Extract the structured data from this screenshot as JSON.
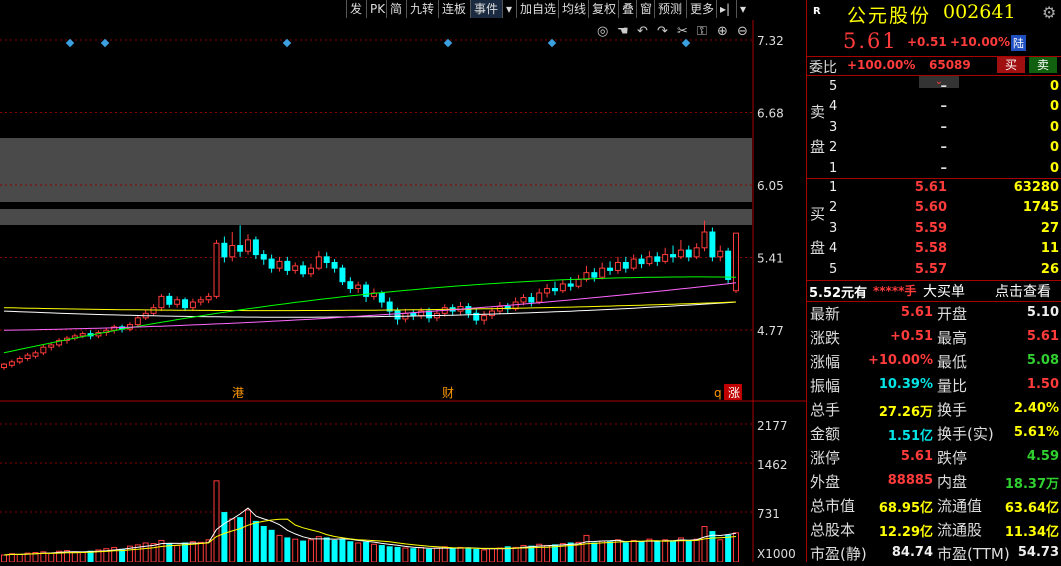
{
  "toolbar": {
    "items": [
      "发",
      "PK",
      "简",
      "九转",
      "连板",
      "事件",
      "▾",
      "加自选",
      "均线",
      "复权",
      "叠",
      "窗",
      "预测",
      "更多",
      "▸|",
      "▾"
    ]
  },
  "chart": {
    "price_ticks": [
      "7.32",
      "6.68",
      "6.05",
      "5.41",
      "4.77"
    ],
    "volume_ticks": [
      "2177",
      "1462",
      "731",
      "X1000"
    ],
    "markers": [
      "港",
      "财",
      "q",
      "涨"
    ],
    "icons": [
      "eye-icon",
      "hand-icon",
      "undo-icon",
      "redo-icon",
      "cut-icon",
      "lock-icon",
      "zoom-in-icon",
      "zoom-out-icon"
    ]
  },
  "chart_data": {
    "type": "candlestick",
    "price_axis": [
      4.77,
      7.32
    ],
    "volume_axis": [
      0,
      2177
    ],
    "volume_unit": "X1000",
    "candles": [
      [
        4.42,
        4.45,
        4.4,
        4.46
      ],
      [
        4.44,
        4.47,
        4.42,
        4.49
      ],
      [
        4.47,
        4.5,
        4.45,
        4.52
      ],
      [
        4.5,
        4.53,
        4.48,
        4.55
      ],
      [
        4.52,
        4.55,
        4.5,
        4.57
      ],
      [
        4.55,
        4.6,
        4.53,
        4.62
      ],
      [
        4.6,
        4.62,
        4.57,
        4.64
      ],
      [
        4.62,
        4.66,
        4.6,
        4.68
      ],
      [
        4.66,
        4.68,
        4.63,
        4.7
      ],
      [
        4.68,
        4.7,
        4.66,
        4.72
      ],
      [
        4.7,
        4.72,
        4.68,
        4.74
      ],
      [
        4.72,
        4.7,
        4.67,
        4.75
      ],
      [
        4.7,
        4.73,
        4.68,
        4.75
      ],
      [
        4.73,
        4.75,
        4.7,
        4.77
      ],
      [
        4.75,
        4.78,
        4.72,
        4.8
      ],
      [
        4.78,
        4.76,
        4.73,
        4.8
      ],
      [
        4.76,
        4.8,
        4.74,
        4.82
      ],
      [
        4.8,
        4.86,
        4.78,
        4.88
      ],
      [
        4.86,
        4.9,
        4.84,
        4.93
      ],
      [
        4.9,
        4.95,
        4.88,
        4.98
      ],
      [
        4.95,
        5.05,
        4.92,
        5.07
      ],
      [
        5.05,
        4.98,
        4.95,
        5.08
      ],
      [
        4.98,
        5.02,
        4.95,
        5.05
      ],
      [
        5.02,
        4.95,
        4.92,
        5.04
      ],
      [
        4.95,
        5.0,
        4.92,
        5.03
      ],
      [
        5.0,
        5.02,
        4.97,
        5.05
      ],
      [
        5.02,
        5.05,
        4.99,
        5.08
      ],
      [
        5.05,
        5.52,
        5.03,
        5.55
      ],
      [
        5.52,
        5.4,
        5.35,
        5.58
      ],
      [
        5.4,
        5.5,
        5.36,
        5.62
      ],
      [
        5.5,
        5.45,
        5.4,
        5.68
      ],
      [
        5.45,
        5.55,
        5.42,
        5.6
      ],
      [
        5.55,
        5.42,
        5.38,
        5.58
      ],
      [
        5.42,
        5.38,
        5.33,
        5.46
      ],
      [
        5.38,
        5.3,
        5.26,
        5.42
      ],
      [
        5.3,
        5.36,
        5.27,
        5.4
      ],
      [
        5.36,
        5.28,
        5.24,
        5.4
      ],
      [
        5.28,
        5.32,
        5.25,
        5.35
      ],
      [
        5.32,
        5.25,
        5.22,
        5.36
      ],
      [
        5.25,
        5.3,
        5.22,
        5.34
      ],
      [
        5.3,
        5.4,
        5.28,
        5.45
      ],
      [
        5.4,
        5.35,
        5.3,
        5.44
      ],
      [
        5.35,
        5.3,
        5.26,
        5.38
      ],
      [
        5.3,
        5.18,
        5.15,
        5.33
      ],
      [
        5.18,
        5.12,
        5.08,
        5.22
      ],
      [
        5.12,
        5.15,
        5.08,
        5.18
      ],
      [
        5.15,
        5.05,
        5.0,
        5.18
      ],
      [
        5.05,
        5.08,
        5.02,
        5.12
      ],
      [
        5.08,
        5.0,
        4.95,
        5.1
      ],
      [
        5.0,
        4.92,
        4.88,
        5.04
      ],
      [
        4.92,
        4.85,
        4.8,
        4.95
      ],
      [
        4.85,
        4.9,
        4.82,
        4.94
      ],
      [
        4.9,
        4.88,
        4.84,
        4.93
      ],
      [
        4.88,
        4.92,
        4.85,
        4.95
      ],
      [
        4.92,
        4.86,
        4.82,
        4.95
      ],
      [
        4.86,
        4.9,
        4.83,
        4.93
      ],
      [
        4.9,
        4.95,
        4.87,
        4.98
      ],
      [
        4.95,
        4.92,
        4.88,
        4.98
      ],
      [
        4.92,
        4.96,
        4.89,
        5.0
      ],
      [
        4.96,
        4.9,
        4.86,
        4.99
      ],
      [
        4.9,
        4.84,
        4.8,
        4.94
      ],
      [
        4.84,
        4.88,
        4.8,
        4.92
      ],
      [
        4.88,
        4.92,
        4.85,
        4.95
      ],
      [
        4.92,
        4.96,
        4.89,
        5.0
      ],
      [
        4.96,
        4.94,
        4.9,
        4.99
      ],
      [
        4.94,
        5.0,
        4.92,
        5.04
      ],
      [
        5.0,
        5.04,
        4.97,
        5.07
      ],
      [
        5.04,
        5.0,
        4.96,
        5.08
      ],
      [
        5.0,
        5.08,
        4.98,
        5.12
      ],
      [
        5.08,
        5.12,
        5.04,
        5.16
      ],
      [
        5.12,
        5.1,
        5.06,
        5.18
      ],
      [
        5.1,
        5.16,
        5.08,
        5.2
      ],
      [
        5.16,
        5.14,
        5.1,
        5.22
      ],
      [
        5.14,
        5.2,
        5.12,
        5.24
      ],
      [
        5.2,
        5.26,
        5.18,
        5.32
      ],
      [
        5.26,
        5.22,
        5.18,
        5.3
      ],
      [
        5.22,
        5.3,
        5.2,
        5.35
      ],
      [
        5.3,
        5.28,
        5.24,
        5.36
      ],
      [
        5.28,
        5.35,
        5.25,
        5.4
      ],
      [
        5.35,
        5.3,
        5.26,
        5.4
      ],
      [
        5.3,
        5.38,
        5.28,
        5.42
      ],
      [
        5.38,
        5.34,
        5.3,
        5.42
      ],
      [
        5.34,
        5.4,
        5.32,
        5.45
      ],
      [
        5.4,
        5.36,
        5.32,
        5.44
      ],
      [
        5.36,
        5.42,
        5.34,
        5.48
      ],
      [
        5.42,
        5.4,
        5.35,
        5.5
      ],
      [
        5.4,
        5.46,
        5.38,
        5.55
      ],
      [
        5.46,
        5.4,
        5.36,
        5.5
      ],
      [
        5.4,
        5.48,
        5.38,
        5.52
      ],
      [
        5.48,
        5.62,
        5.45,
        5.72
      ],
      [
        5.62,
        5.4,
        5.36,
        5.66
      ],
      [
        5.4,
        5.45,
        5.36,
        5.5
      ],
      [
        5.45,
        5.2,
        5.16,
        5.48
      ],
      [
        5.1,
        5.61,
        5.08,
        5.61
      ]
    ],
    "volumes": [
      110,
      130,
      120,
      140,
      150,
      160,
      140,
      170,
      180,
      160,
      150,
      170,
      190,
      210,
      230,
      200,
      250,
      270,
      300,
      290,
      340,
      280,
      260,
      300,
      320,
      310,
      350,
      1280,
      780,
      680,
      700,
      820,
      640,
      560,
      500,
      420,
      380,
      360,
      330,
      350,
      400,
      380,
      340,
      360,
      320,
      300,
      310,
      280,
      260,
      240,
      230,
      220,
      210,
      230,
      200,
      220,
      240,
      210,
      230,
      220,
      200,
      190,
      210,
      220,
      240,
      230,
      260,
      250,
      280,
      260,
      270,
      290,
      300,
      310,
      420,
      300,
      330,
      320,
      350,
      300,
      340,
      310,
      360,
      320,
      350,
      330,
      380,
      340,
      360,
      560,
      480,
      350,
      420,
      460
    ],
    "ma_series": [
      {
        "color": "#ffffff",
        "start": 4.92,
        "mid": 4.78,
        "end": 5.0
      },
      {
        "color": "#ffff00",
        "start": 4.95,
        "mid": 4.88,
        "end": 5.0
      },
      {
        "color": "#00ff00",
        "start": 4.55,
        "mid": 5.26,
        "end": 5.22
      },
      {
        "color": "#ff66ff",
        "start": 4.75,
        "mid": 4.8,
        "end": 5.17
      }
    ]
  },
  "stock": {
    "flag": "R",
    "name": "公元股份",
    "code": "002641",
    "price": "5.61",
    "change": "+0.51",
    "pct": "+10.00%",
    "tag": "陆"
  },
  "weibi": {
    "label": "委比",
    "ratio": "+100.00%",
    "diff": "65089",
    "buy_btn": "买",
    "sell_btn": "卖"
  },
  "sell_side": {
    "label1": "卖",
    "label2": "盘",
    "rows": [
      {
        "lv": "5",
        "p": "–",
        "v": "0"
      },
      {
        "lv": "4",
        "p": "–",
        "v": "0"
      },
      {
        "lv": "3",
        "p": "–",
        "v": "0"
      },
      {
        "lv": "2",
        "p": "–",
        "v": "0"
      },
      {
        "lv": "1",
        "p": "–",
        "v": "0"
      }
    ]
  },
  "buy_side": {
    "label1": "买",
    "label2": "盘",
    "rows": [
      {
        "lv": "1",
        "p": "5.61",
        "v": "63280"
      },
      {
        "lv": "2",
        "p": "5.60",
        "v": "1745"
      },
      {
        "lv": "3",
        "p": "5.59",
        "v": "27"
      },
      {
        "lv": "4",
        "p": "5.58",
        "v": "11"
      },
      {
        "lv": "5",
        "p": "5.57",
        "v": "26"
      }
    ]
  },
  "promo": {
    "price": "5.52元有",
    "stars": "*****手",
    "text": "大买单",
    "link": "点击查看"
  },
  "quotes": [
    {
      "l1": "最新",
      "v1": "5.61",
      "c1": "red",
      "l2": "开盘",
      "v2": "5.10",
      "c2": "wht"
    },
    {
      "l1": "涨跌",
      "v1": "+0.51",
      "c1": "red",
      "l2": "最高",
      "v2": "5.61",
      "c2": "red"
    },
    {
      "l1": "涨幅",
      "v1": "+10.00%",
      "c1": "red",
      "l2": "最低",
      "v2": "5.08",
      "c2": "grn"
    },
    {
      "l1": "振幅",
      "v1": "10.39%",
      "c1": "cyan",
      "l2": "量比",
      "v2": "1.50",
      "c2": "red"
    },
    {
      "l1": "总手",
      "v1": "27.26万",
      "c1": "yel",
      "l2": "换手",
      "v2": "2.40%",
      "c2": "yel"
    },
    {
      "l1": "金额",
      "v1": "1.51亿",
      "c1": "cyan",
      "l2": "换手(实)",
      "v2": "5.61%",
      "c2": "yel"
    },
    {
      "l1": "涨停",
      "v1": "5.61",
      "c1": "red",
      "l2": "跌停",
      "v2": "4.59",
      "c2": "grn"
    },
    {
      "l1": "外盘",
      "v1": "88885",
      "c1": "red",
      "l2": "内盘",
      "v2": "18.37万",
      "c2": "grn"
    },
    {
      "l1": "总市值",
      "v1": "68.95亿",
      "c1": "yel",
      "l2": "流通值",
      "v2": "63.64亿",
      "c2": "yel"
    },
    {
      "l1": "总股本",
      "v1": "12.29亿",
      "c1": "yel",
      "l2": "流通股",
      "v2": "11.34亿",
      "c2": "yel"
    },
    {
      "l1": "市盈(静)",
      "v1": "84.74",
      "c1": "wht",
      "l2": "市盈(TTM)",
      "v2": "54.73",
      "c2": "wht"
    }
  ]
}
